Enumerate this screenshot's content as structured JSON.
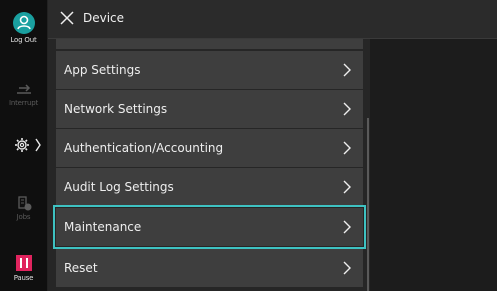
{
  "header": {
    "title": "Device"
  },
  "sidebar": {
    "logout_label": "Log Out",
    "interrupt_label": "Interrupt",
    "jobs_label": "Jobs",
    "pause_label": "Pause"
  },
  "menu": {
    "items": [
      {
        "label": "App Settings"
      },
      {
        "label": "Network Settings"
      },
      {
        "label": "Authentication/Accounting"
      },
      {
        "label": "Audit Log Settings"
      },
      {
        "label": "Maintenance",
        "selected": true
      },
      {
        "label": "Reset"
      }
    ]
  },
  "colors": {
    "accent": "#3ec2c2",
    "logout": "#1aa0a0",
    "pause": "#e0245e",
    "item_bg": "#3e3e3e"
  },
  "icons": {
    "close": "close-icon",
    "logout": "person-icon",
    "interrupt": "interrupt-icon",
    "device": "gear-icon",
    "jobs": "jobs-icon",
    "pause": "pause-icon",
    "chevron": "chevron-right-icon"
  }
}
